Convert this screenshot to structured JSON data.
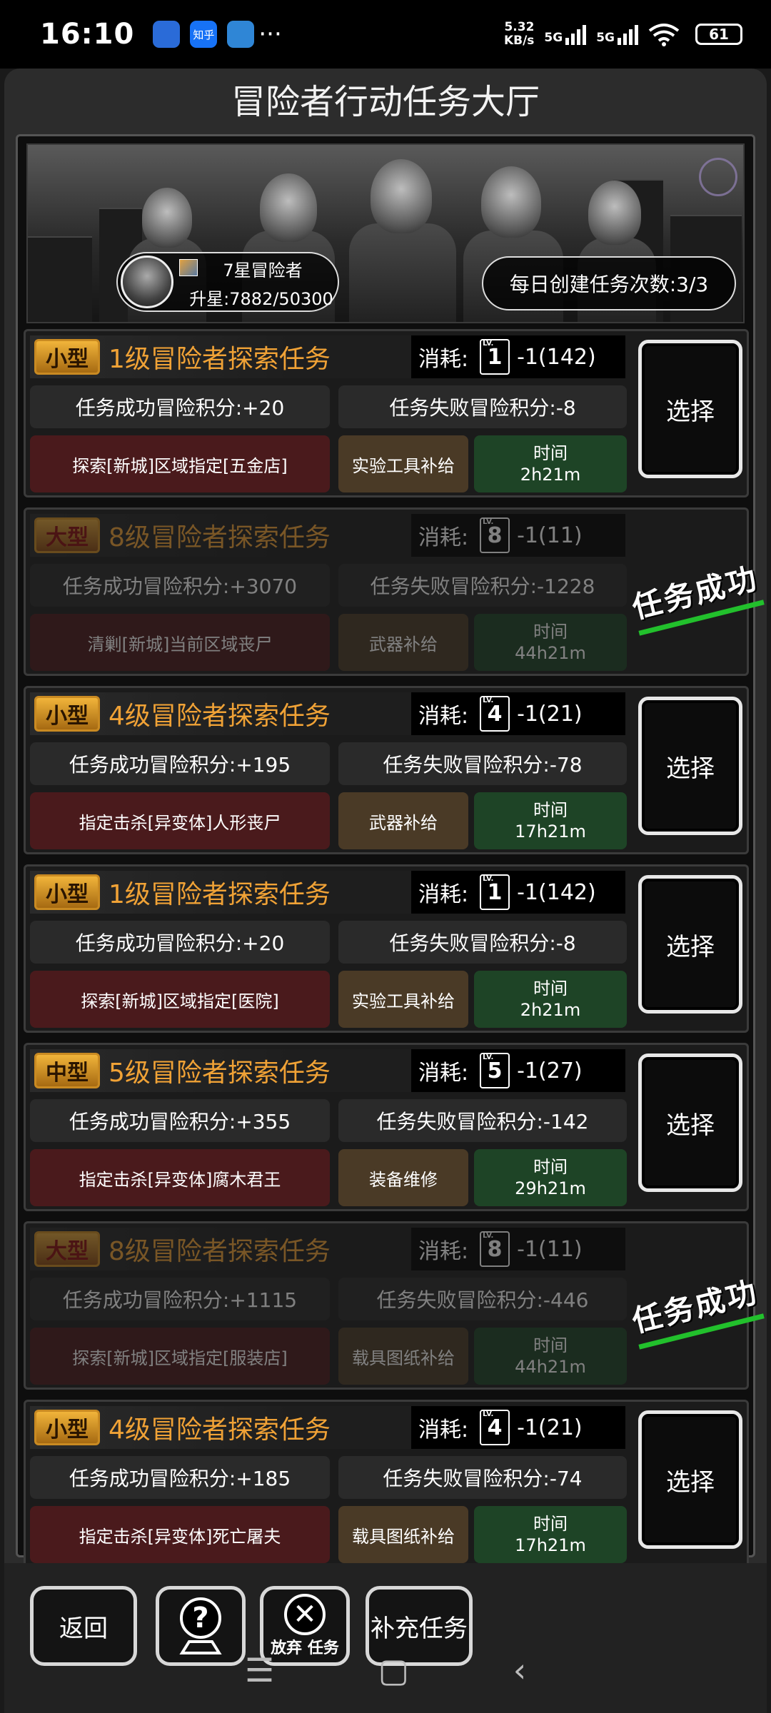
{
  "status_bar": {
    "time": "16:10",
    "apps": [
      {
        "name": "app-icon-1",
        "label": "",
        "color": "#2a6bd8"
      },
      {
        "name": "zhihu-icon",
        "label": "知乎",
        "color": "#1772f6"
      },
      {
        "name": "app-icon-3",
        "label": "",
        "color": "#2f86d6"
      }
    ],
    "more": "···",
    "speed_value": "5.32",
    "speed_unit": "KB/s",
    "net1": "5G",
    "net2": "5G",
    "battery": "61"
  },
  "title": "冒险者行动任务大厅",
  "player": {
    "rank": "7星冒险者",
    "upgrade": "升星:7882/50300"
  },
  "daily": "每日创建任务次数:3/3",
  "cost_label": "消耗:",
  "lv_label": "LV.",
  "time_label": "时间",
  "select_label": "选择",
  "done_label": "任务成功",
  "tasks": [
    {
      "size": "小型",
      "title": "1级冒险者探索任务",
      "lv": "1",
      "cost": "-1(142)",
      "success": "任务成功冒险积分:+20",
      "fail": "任务失败冒险积分:-8",
      "target": "探索[新城]区域指定[五金店]",
      "reward": "实验工具补给",
      "time": "2h21m",
      "done": false
    },
    {
      "size": "大型",
      "title": "8级冒险者探索任务",
      "lv": "8",
      "cost": "-1(11)",
      "success": "任务成功冒险积分:+3070",
      "fail": "任务失败冒险积分:-1228",
      "target": "清剿[新城]当前区域丧尸",
      "reward": "武器补给",
      "time": "44h21m",
      "done": true
    },
    {
      "size": "小型",
      "title": "4级冒险者探索任务",
      "lv": "4",
      "cost": "-1(21)",
      "success": "任务成功冒险积分:+195",
      "fail": "任务失败冒险积分:-78",
      "target": "指定击杀[异变体]人形丧尸",
      "reward": "武器补给",
      "time": "17h21m",
      "done": false
    },
    {
      "size": "小型",
      "title": "1级冒险者探索任务",
      "lv": "1",
      "cost": "-1(142)",
      "success": "任务成功冒险积分:+20",
      "fail": "任务失败冒险积分:-8",
      "target": "探索[新城]区域指定[医院]",
      "reward": "实验工具补给",
      "time": "2h21m",
      "done": false
    },
    {
      "size": "中型",
      "title": "5级冒险者探索任务",
      "lv": "5",
      "cost": "-1(27)",
      "success": "任务成功冒险积分:+355",
      "fail": "任务失败冒险积分:-142",
      "target": "指定击杀[异变体]腐木君王",
      "reward": "装备维修",
      "time": "29h21m",
      "done": false
    },
    {
      "size": "大型",
      "title": "8级冒险者探索任务",
      "lv": "8",
      "cost": "-1(11)",
      "success": "任务成功冒险积分:+1115",
      "fail": "任务失败冒险积分:-446",
      "target": "探索[新城]区域指定[服装店]",
      "reward": "载具图纸补给",
      "time": "44h21m",
      "done": true
    },
    {
      "size": "小型",
      "title": "4级冒险者探索任务",
      "lv": "4",
      "cost": "-1(21)",
      "success": "任务成功冒险积分:+185",
      "fail": "任务失败冒险积分:-74",
      "target": "指定击杀[异变体]死亡屠夫",
      "reward": "载具图纸补给",
      "time": "17h21m",
      "done": false
    }
  ],
  "bottom": {
    "back": "返回",
    "help_icon": "?",
    "abandon_icon": "✕",
    "abandon": "放弃 任务",
    "refill": "补充任务"
  },
  "nav": {
    "menu": "☰",
    "home": "▢",
    "back": "‹"
  }
}
